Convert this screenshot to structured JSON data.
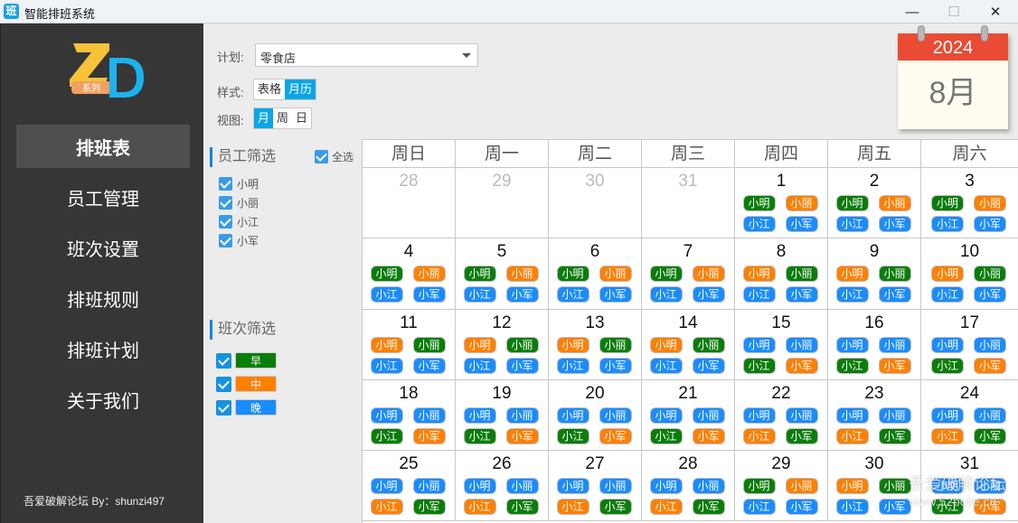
{
  "window": {
    "app_icon_glyph": "班",
    "title": "智能排班系统",
    "controls": {
      "minimize": "—",
      "maximize": "☐",
      "close": "✕"
    }
  },
  "sidebar": {
    "logo": {
      "letters": "ZD",
      "tag": "系列"
    },
    "items": [
      {
        "label": "排班表",
        "active": true
      },
      {
        "label": "员工管理",
        "active": false
      },
      {
        "label": "班次设置",
        "active": false
      },
      {
        "label": "排班规则",
        "active": false
      },
      {
        "label": "排班计划",
        "active": false
      },
      {
        "label": "关于我们",
        "active": false
      }
    ],
    "footer": "吾爱破解论坛 By：shunzi497"
  },
  "toolbar": {
    "plan_label": "计划:",
    "plan_value": "零食店",
    "style_label": "样式:",
    "style_options": [
      {
        "label": "表格",
        "selected": false
      },
      {
        "label": "月历",
        "selected": true
      }
    ],
    "view_label": "视图:",
    "view_options": [
      {
        "label": "月",
        "selected": true
      },
      {
        "label": "周",
        "selected": false
      },
      {
        "label": "日",
        "selected": false
      }
    ]
  },
  "calendar_badge": {
    "year": "2024",
    "month": "8月"
  },
  "filters": {
    "employee_title": "员工筛选",
    "select_all_label": "全选",
    "select_all_checked": true,
    "employees": [
      {
        "name": "小明",
        "checked": true
      },
      {
        "name": "小丽",
        "checked": true
      },
      {
        "name": "小江",
        "checked": true
      },
      {
        "name": "小军",
        "checked": true
      }
    ],
    "shift_title": "班次筛选",
    "shifts": [
      {
        "name": "早",
        "key": "early",
        "color": "#0a7d0a",
        "checked": true
      },
      {
        "name": "中",
        "key": "mid",
        "color": "#ff8000",
        "checked": true
      },
      {
        "name": "晚",
        "key": "late",
        "color": "#1a8cff",
        "checked": true
      }
    ]
  },
  "shift_colors": {
    "early": "#0a7d0a",
    "mid": "#ff8000",
    "late": "#1a8cff"
  },
  "weekdays": [
    "周日",
    "周一",
    "周二",
    "周三",
    "周四",
    "周五",
    "周六"
  ],
  "employees_order": [
    "小明",
    "小丽",
    "小江",
    "小军"
  ],
  "days": [
    {
      "day": "28",
      "current": false,
      "shifts": []
    },
    {
      "day": "29",
      "current": false,
      "shifts": []
    },
    {
      "day": "30",
      "current": false,
      "shifts": []
    },
    {
      "day": "31",
      "current": false,
      "shifts": []
    },
    {
      "day": "1",
      "current": true,
      "shifts": [
        "early",
        "mid",
        "late",
        "late"
      ]
    },
    {
      "day": "2",
      "current": true,
      "shifts": [
        "early",
        "mid",
        "late",
        "late"
      ]
    },
    {
      "day": "3",
      "current": true,
      "shifts": [
        "early",
        "mid",
        "late",
        "late"
      ]
    },
    {
      "day": "4",
      "current": true,
      "shifts": [
        "early",
        "mid",
        "late",
        "late"
      ]
    },
    {
      "day": "5",
      "current": true,
      "shifts": [
        "early",
        "mid",
        "late",
        "late"
      ]
    },
    {
      "day": "6",
      "current": true,
      "shifts": [
        "early",
        "mid",
        "late",
        "late"
      ]
    },
    {
      "day": "7",
      "current": true,
      "shifts": [
        "early",
        "mid",
        "late",
        "late"
      ]
    },
    {
      "day": "8",
      "current": true,
      "shifts": [
        "mid",
        "early",
        "late",
        "late"
      ]
    },
    {
      "day": "9",
      "current": true,
      "shifts": [
        "mid",
        "early",
        "late",
        "late"
      ]
    },
    {
      "day": "10",
      "current": true,
      "shifts": [
        "mid",
        "early",
        "late",
        "late"
      ]
    },
    {
      "day": "11",
      "current": true,
      "shifts": [
        "mid",
        "early",
        "late",
        "late"
      ]
    },
    {
      "day": "12",
      "current": true,
      "shifts": [
        "mid",
        "early",
        "late",
        "late"
      ]
    },
    {
      "day": "13",
      "current": true,
      "shifts": [
        "mid",
        "early",
        "late",
        "late"
      ]
    },
    {
      "day": "14",
      "current": true,
      "shifts": [
        "mid",
        "early",
        "late",
        "late"
      ]
    },
    {
      "day": "15",
      "current": true,
      "shifts": [
        "late",
        "late",
        "early",
        "mid"
      ]
    },
    {
      "day": "16",
      "current": true,
      "shifts": [
        "late",
        "late",
        "early",
        "mid"
      ]
    },
    {
      "day": "17",
      "current": true,
      "shifts": [
        "late",
        "late",
        "early",
        "mid"
      ]
    },
    {
      "day": "18",
      "current": true,
      "shifts": [
        "late",
        "late",
        "early",
        "mid"
      ]
    },
    {
      "day": "19",
      "current": true,
      "shifts": [
        "late",
        "late",
        "early",
        "mid"
      ]
    },
    {
      "day": "20",
      "current": true,
      "shifts": [
        "late",
        "late",
        "early",
        "mid"
      ]
    },
    {
      "day": "21",
      "current": true,
      "shifts": [
        "late",
        "late",
        "early",
        "mid"
      ]
    },
    {
      "day": "22",
      "current": true,
      "shifts": [
        "late",
        "late",
        "mid",
        "early"
      ]
    },
    {
      "day": "23",
      "current": true,
      "shifts": [
        "late",
        "late",
        "mid",
        "early"
      ]
    },
    {
      "day": "24",
      "current": true,
      "shifts": [
        "late",
        "late",
        "mid",
        "early"
      ]
    },
    {
      "day": "25",
      "current": true,
      "shifts": [
        "late",
        "late",
        "mid",
        "early"
      ]
    },
    {
      "day": "26",
      "current": true,
      "shifts": [
        "late",
        "late",
        "mid",
        "early"
      ]
    },
    {
      "day": "27",
      "current": true,
      "shifts": [
        "late",
        "late",
        "mid",
        "early"
      ]
    },
    {
      "day": "28",
      "current": true,
      "shifts": [
        "late",
        "late",
        "mid",
        "early"
      ]
    },
    {
      "day": "29",
      "current": true,
      "shifts": [
        "early",
        "mid",
        "late",
        "late"
      ]
    },
    {
      "day": "30",
      "current": true,
      "shifts": [
        "mid",
        "early",
        "late",
        "late"
      ]
    },
    {
      "day": "31",
      "current": true,
      "shifts": [
        "late",
        "late",
        "early",
        "mid"
      ]
    }
  ],
  "watermark": {
    "line1": "吾爱破解论坛",
    "line2": "www.52pojie.cn"
  }
}
